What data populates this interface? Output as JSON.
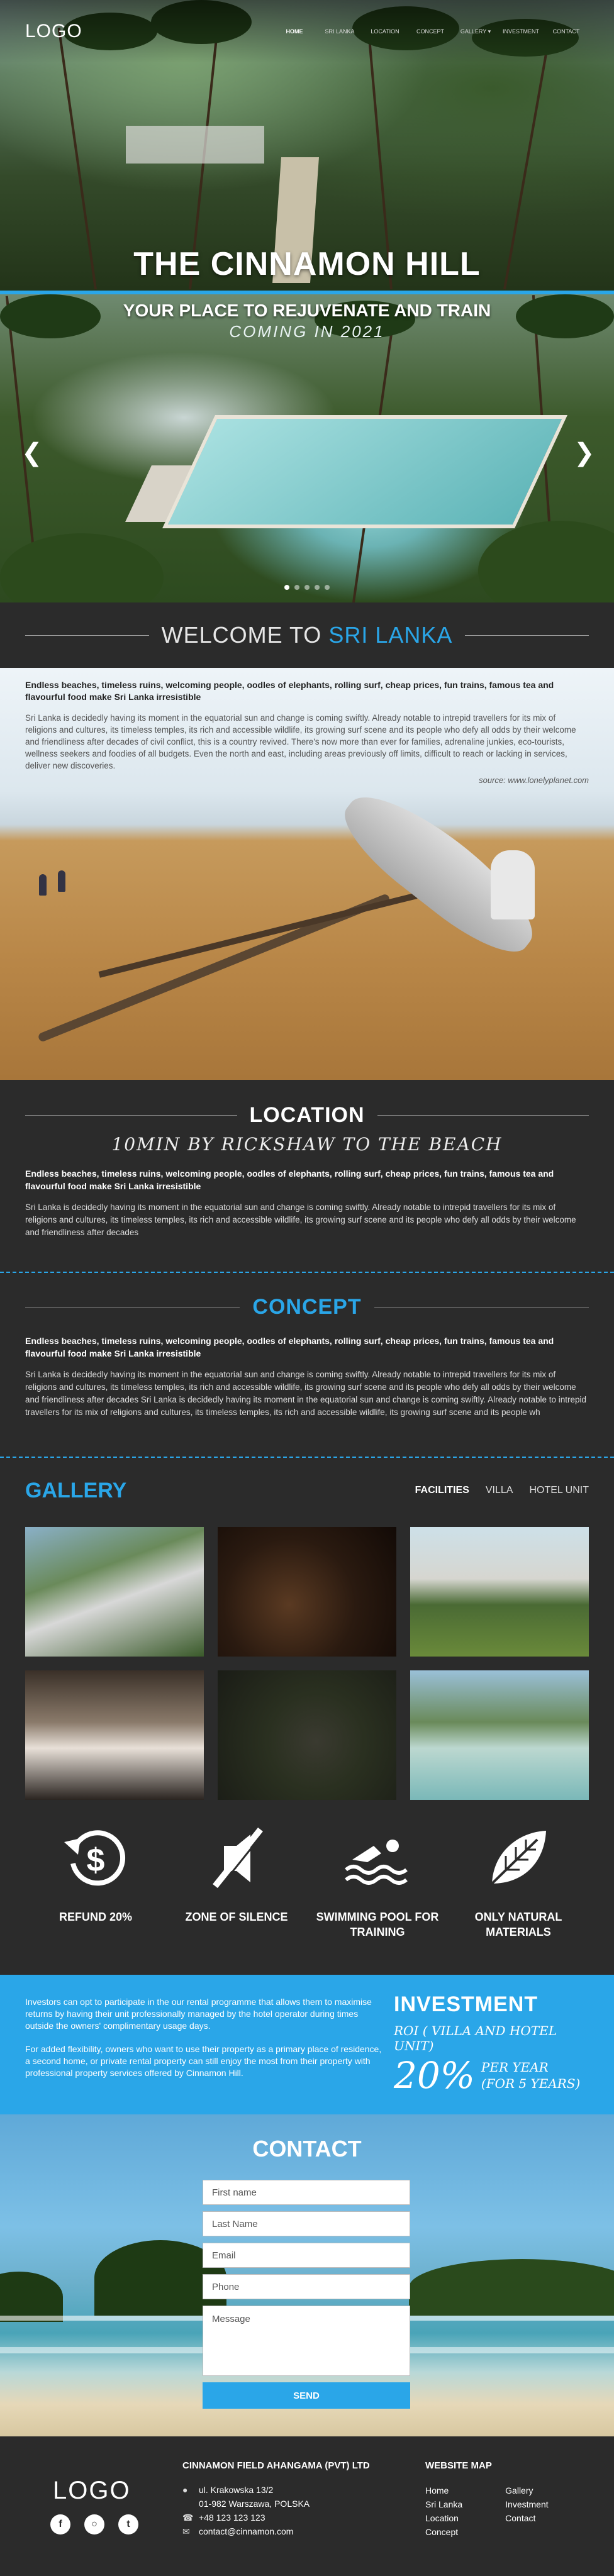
{
  "nav": {
    "logo": "LOGO",
    "links": [
      "HOME",
      "SRI LANKA",
      "LOCATION",
      "CONCEPT",
      "GALLERY ▾",
      "INVESTMENT",
      "CONTACT"
    ]
  },
  "hero": {
    "title": "THE CINNAMON HILL",
    "subtitle": "YOUR PLACE TO REJUVENATE AND TRAIN",
    "coming": "COMING IN 2021",
    "prev_icon": "chevron-left-icon",
    "next_icon": "chevron-right-icon",
    "dots": 5
  },
  "welcome": {
    "title_prefix": "WELCOME TO",
    "title_accent": "SRI LANKA",
    "bold": "Endless beaches, timeless ruins, welcoming people, oodles of elephants, rolling surf, cheap prices, fun trains, famous tea and flavourful food make Sri Lanka irresistible",
    "para": "Sri Lanka is decidedly having its moment in the equatorial sun and change is coming swiftly. Already notable to intrepid travellers for its mix of religions and cultures, its timeless temples, its rich and accessible wildlife, its growing surf scene and its people who defy all odds by their welcome and friendliness after decades of civil conflict, this is a country revived. There's now more than ever for families, adrenaline junkies, eco-tourists, wellness seekers and foodies of all budgets. Even the north and east, including areas previously off limits, difficult to reach or lacking in services, deliver new discoveries.",
    "source": "source: www.lonelyplanet.com"
  },
  "location": {
    "title": "LOCATION",
    "tagline": "10MIN BY RICKSHAW TO THE BEACH",
    "bold": "Endless beaches, timeless ruins, welcoming people, oodles of elephants, rolling surf, cheap prices, fun trains, famous tea and flavourful food make Sri Lanka irresistible",
    "para": "Sri Lanka is decidedly having its moment in the equatorial sun and change is coming swiftly. Already notable to intrepid travellers for its mix of religions and cultures, its timeless temples, its rich and accessible wildlife, its growing surf scene and its people who defy all odds by their welcome and friendliness after decades"
  },
  "concept": {
    "title": "CONCEPT",
    "bold": "Endless beaches, timeless ruins, welcoming people, oodles of elephants, rolling surf, cheap prices, fun trains, famous tea and flavourful food make Sri Lanka irresistible",
    "para": "Sri Lanka is decidedly having its moment in the equatorial sun and change is coming swiftly. Already notable to intrepid travellers for its mix of religions and cultures, its timeless temples, its rich and accessible wildlife, its growing surf scene and its people who defy all odds by their welcome and friendliness after decades Sri Lanka is decidedly having its moment in the equatorial sun and change is coming swiftly. Already notable to intrepid travellers for its mix of religions and cultures, its timeless temples, its rich and accessible wildlife, its growing surf scene and its people wh"
  },
  "gallery": {
    "title": "GALLERY",
    "tabs": [
      "FACILITIES",
      "VILLA",
      "HOTEL UNIT"
    ]
  },
  "features": [
    {
      "label": "REFUND 20%",
      "icon": "refund-dollar-icon"
    },
    {
      "label": "ZONE OF SILENCE",
      "icon": "silence-icon"
    },
    {
      "label": "SWIMMING POOL FOR TRAINING",
      "icon": "swimmer-icon"
    },
    {
      "label": "ONLY NATURAL MATERIALS",
      "icon": "leaf-icon"
    }
  ],
  "investment": {
    "p1": "Investors can opt to participate in the our rental programme that allows them to maximise returns by having their unit professionally managed by the hotel operator during times outside the owners' complimentary usage days.",
    "p2": "For added flexibility, owners who want to use their property as a primary place of residence, a second home, or private rental property can still enjoy the most from their property with professional property services offered by Cinnamon Hill.",
    "title": "INVESTMENT",
    "roi": "ROI ( VILLA AND HOTEL UNIT)",
    "percent": "20%",
    "per_year": "PER YEAR",
    "years": "(FOR 5 YEARS)"
  },
  "contact": {
    "title": "CONTACT",
    "fields": [
      "First name",
      "Last Name",
      "Email",
      "Phone"
    ],
    "message": "Message",
    "send": "SEND"
  },
  "footer": {
    "logo": "LOGO",
    "company": "CINNAMON FIELD AHANGAMA (PVT) LTD",
    "address1": "ul. Krakowska 13/2",
    "address2": "01-982 Warszawa, POLSKA",
    "phone": "+48 123 123 123",
    "email": "contact@cinnamon.com",
    "sitemap_title": "WEBSITE MAP",
    "sitemap_col1": [
      "Home",
      "Sri Lanka",
      "Location",
      "Concept"
    ],
    "sitemap_col2": [
      "Gallery",
      "Investment",
      "Contact"
    ],
    "social": [
      "facebook-icon",
      "instagram-icon",
      "twitter-icon"
    ]
  },
  "colors": {
    "accent": "#2aa6e8",
    "dark": "#2b2b2b"
  }
}
